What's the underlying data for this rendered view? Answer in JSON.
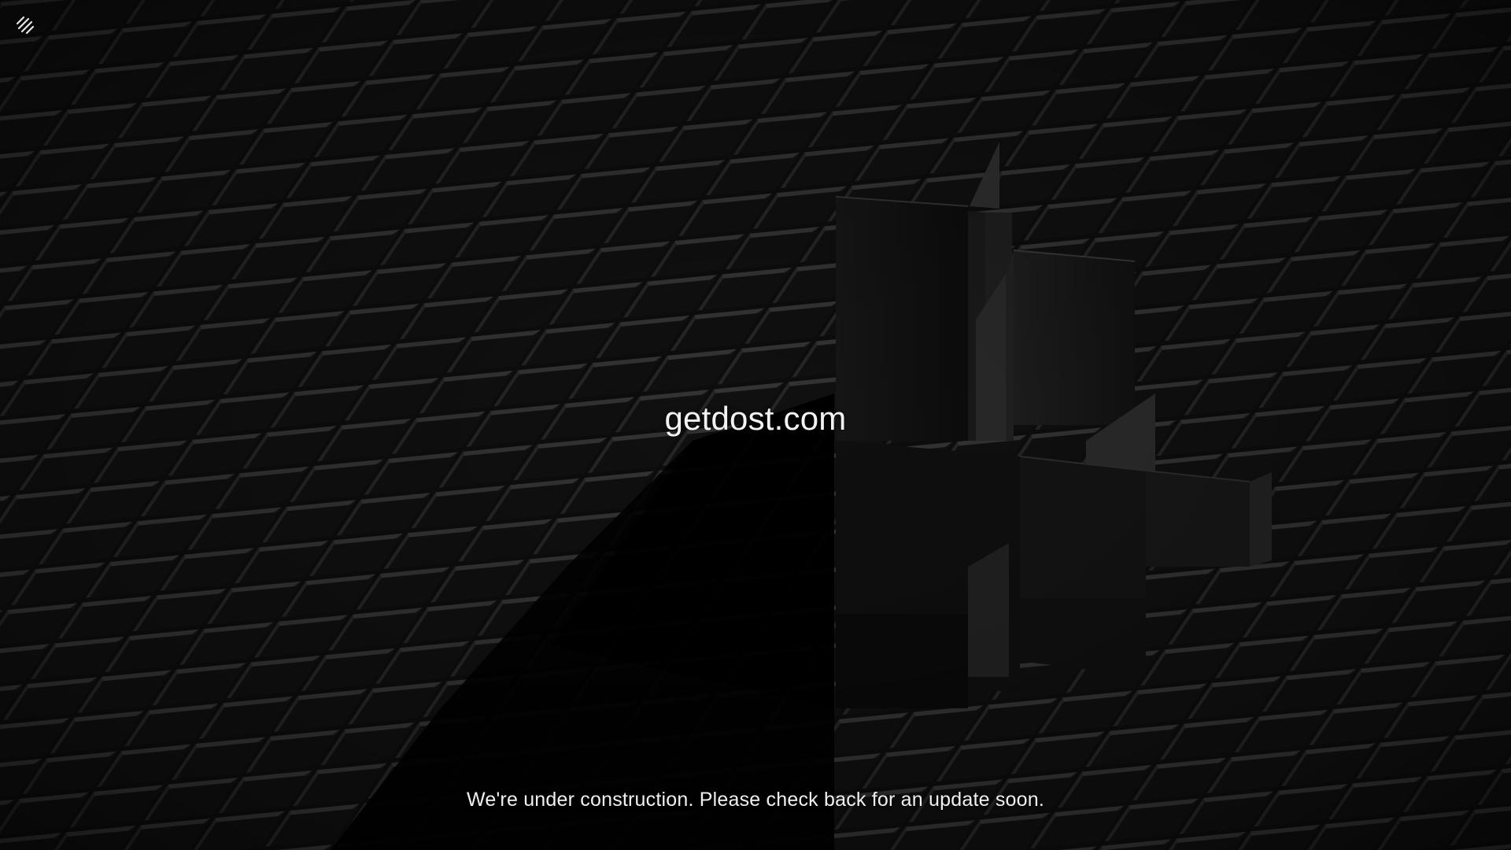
{
  "brand": {
    "logo_icon": "squarespace-logo-icon"
  },
  "hero": {
    "title": "getdost.com"
  },
  "footer": {
    "message": "We're under construction. Please check back for an update soon."
  },
  "colors": {
    "background": "#0a0a0a",
    "tile_top": "#2e2e2e",
    "tile_face": "#141414",
    "text": "#f2f2f2"
  }
}
